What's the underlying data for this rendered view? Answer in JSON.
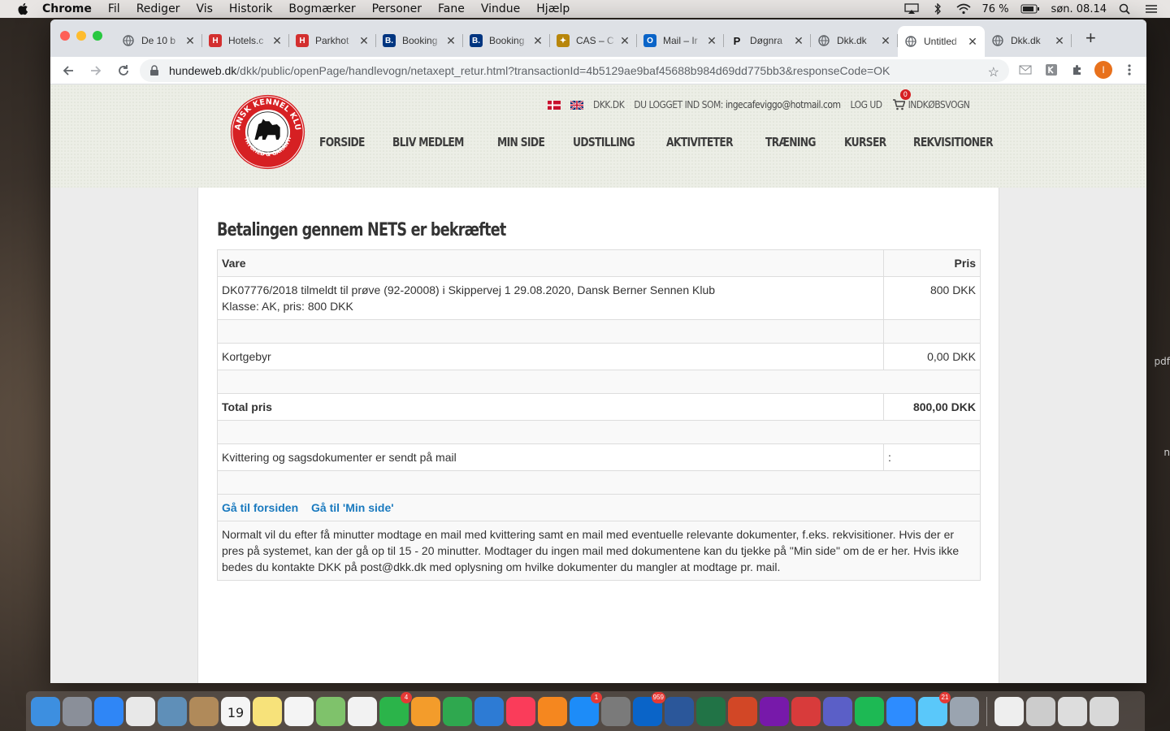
{
  "menubar": {
    "app": "Chrome",
    "items": [
      "Fil",
      "Rediger",
      "Vis",
      "Historik",
      "Bogmærker",
      "Personer",
      "Fane",
      "Vindue",
      "Hjælp"
    ],
    "battery": "76 %",
    "clock": "søn. 08.14"
  },
  "desktop": {
    "side_text_1": "pdf",
    "side_text_2": "n"
  },
  "browser": {
    "tabs": [
      {
        "title": "De 10 b",
        "icon": "globe-icon",
        "color": "#5f6368"
      },
      {
        "title": "Hotels.c",
        "icon": "hotels-icon",
        "color": "#d32f2f"
      },
      {
        "title": "Parkhot",
        "icon": "hotels-icon",
        "color": "#d32f2f"
      },
      {
        "title": "Booking",
        "icon": "booking-icon",
        "color": "#003580"
      },
      {
        "title": "Booking",
        "icon": "booking-icon",
        "color": "#003580"
      },
      {
        "title": "CAS – C",
        "icon": "cas-icon",
        "color": "#b8860b"
      },
      {
        "title": "Mail – Ir",
        "icon": "outlook-icon",
        "color": "#0a64c8"
      },
      {
        "title": "Døgnra",
        "icon": "p-icon",
        "color": "#111111"
      },
      {
        "title": "Dkk.dk",
        "icon": "globe-icon",
        "color": "#5f6368"
      },
      {
        "title": "Untitled",
        "icon": "globe-icon",
        "color": "#5f6368",
        "active": true
      },
      {
        "title": "Dkk.dk",
        "icon": "globe-icon",
        "color": "#5f6368"
      }
    ],
    "new_tab": "+",
    "url_host": "hundeweb.dk",
    "url_path": "/dkk/public/openPage/handlevogn/netaxept_retur.html?transactionId=4b5129ae9baf45688b984d69dd775bb3&responseCode=OK",
    "profile_initial": "I"
  },
  "site": {
    "logo_text_top": "DANSK KENNEL KLUB",
    "logo_text_bottom": "TRYGHED & GARANTI",
    "topbar": {
      "site_link": "DKK.DK",
      "logged_in_label": "DU LOGGET IND SOM:",
      "user_email": "ingecafeviggo@hotmail.com",
      "logout": "LOG UD",
      "cart_count": "0",
      "cart_label": "INDKØBSVOGN"
    },
    "nav": [
      "FORSIDE",
      "BLIV MEDLEM",
      "MIN SIDE",
      "UDSTILLING",
      "AKTIVITETER",
      "TRÆNING",
      "KURSER",
      "REKVISITIONER"
    ]
  },
  "receipt": {
    "title": "Betalingen gennem NETS er bekræftet",
    "col_item": "Vare",
    "col_price": "Pris",
    "item_line1": "DK07776/2018 tilmeldt til prøve (92-20008) i Skippervej 1 29.08.2020, Dansk Berner Sennen Klub",
    "item_line2": "Klasse: AK, pris: 800 DKK",
    "item_price": "800 DKK",
    "fee_label": "Kortgebyr",
    "fee_price": "0,00 DKK",
    "total_label": "Total pris",
    "total_price": "800,00 DKK",
    "mail_label": "Kvittering og sagsdokumenter er sendt på mail",
    "mail_value": ":",
    "link_home": "Gå til forsiden",
    "link_mypage": "Gå til 'Min side'",
    "note": "Normalt vil du efter få minutter modtage en mail med kvittering samt en mail med eventuelle relevante dokumenter, f.eks. rekvisitioner. Hvis der er pres på systemet, kan der gå op til 15 - 20 minutter. Modtager du ingen mail med dokumentene kan du tjekke på \"Min side\" om de er her. Hvis ikke bedes du kontakte DKK på post@dkk.dk med oplysning om hvilke dokumenter du mangler at modtage pr. mail."
  },
  "dock": {
    "icons": [
      {
        "name": "finder-icon",
        "color": "#3d8fe0"
      },
      {
        "name": "launchpad-icon",
        "color": "#8a8f99"
      },
      {
        "name": "safari-icon",
        "color": "#2f86f6"
      },
      {
        "name": "chrome-icon",
        "color": "#e8e8e8"
      },
      {
        "name": "preview-icon",
        "color": "#5f8fb8"
      },
      {
        "name": "contacts-icon",
        "color": "#b08a5a"
      },
      {
        "name": "calendar-icon",
        "color": "#f5f5f5",
        "label": "19"
      },
      {
        "name": "notes-icon",
        "color": "#f7e27a"
      },
      {
        "name": "reminders-icon",
        "color": "#f4f4f4"
      },
      {
        "name": "maps-icon",
        "color": "#7fc26b"
      },
      {
        "name": "photos-icon",
        "color": "#f2f2f2"
      },
      {
        "name": "facetime-icon",
        "color": "#2bb44a",
        "badge": "4"
      },
      {
        "name": "pages-icon",
        "color": "#f39c2b"
      },
      {
        "name": "numbers-icon",
        "color": "#2fa84f"
      },
      {
        "name": "keynote-icon",
        "color": "#2d7bd4"
      },
      {
        "name": "music-icon",
        "color": "#fa3c5a"
      },
      {
        "name": "books-icon",
        "color": "#f5871f"
      },
      {
        "name": "appstore-icon",
        "color": "#1d8cf8",
        "badge": "1"
      },
      {
        "name": "system-preferences-icon",
        "color": "#7a7a7a"
      },
      {
        "name": "outlook-icon",
        "color": "#0a64c8",
        "badge": "959"
      },
      {
        "name": "word-icon",
        "color": "#2b579a"
      },
      {
        "name": "excel-icon",
        "color": "#217346"
      },
      {
        "name": "powerpoint-icon",
        "color": "#d24726"
      },
      {
        "name": "onenote-icon",
        "color": "#7719aa"
      },
      {
        "name": "remote-desktop-icon",
        "color": "#d83b3b"
      },
      {
        "name": "teams-icon",
        "color": "#5b5fc7"
      },
      {
        "name": "spotify-icon",
        "color": "#1db954"
      },
      {
        "name": "zoom-icon",
        "color": "#2d8cff"
      },
      {
        "name": "messages-icon",
        "color": "#5ac8fa",
        "badge": "21"
      },
      {
        "name": "screenshot-icon",
        "color": "#9aa4b0"
      }
    ],
    "right_icons": [
      {
        "name": "document-icon",
        "color": "#eeeeee"
      },
      {
        "name": "help-icon",
        "color": "#cccccc"
      },
      {
        "name": "downloads-icon",
        "color": "#dddddd"
      },
      {
        "name": "trash-icon",
        "color": "#d8d8d8"
      }
    ]
  }
}
